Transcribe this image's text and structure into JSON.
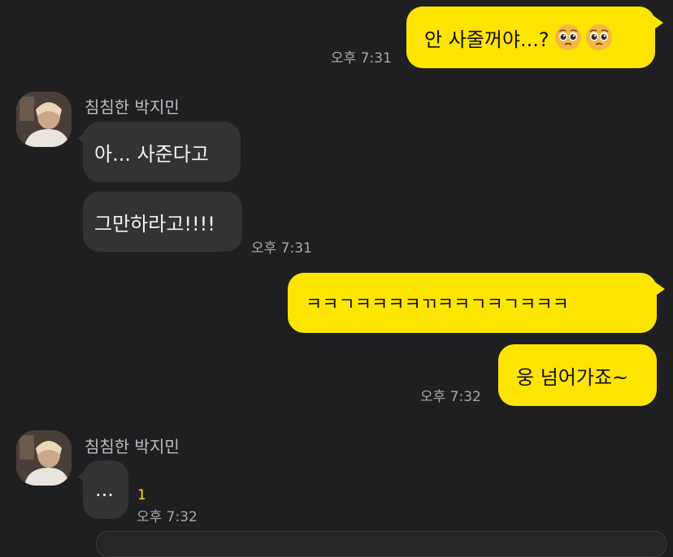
{
  "messages": {
    "m1": {
      "text": "안 사줄꺼야...? ",
      "emoji": [
        "pleading-face-emoji",
        "pleading-face-emoji"
      ],
      "time": "오후 7:31"
    },
    "group1": {
      "sender": "침침한 박지민",
      "avatar": "avatar-photo",
      "m2": "아... 사준다고",
      "m3": "그만하라고!!!!",
      "time": "오후 7:31"
    },
    "m4": {
      "text": "ㅋㅋㄱㅋㅋㅋㅋㄲㅋㅋㄱㅋㄱㅋㅋㅋ"
    },
    "m5": {
      "text": "웅 넘어가죠~",
      "time": "오후 7:32"
    },
    "group2": {
      "sender": "침침한 박지민",
      "avatar": "avatar-photo",
      "m6": "...",
      "unread": "1",
      "time": "오후 7:32"
    }
  },
  "colors": {
    "background": "#1f1f21",
    "my_bubble": "#fee500",
    "other_bubble": "#333336"
  }
}
